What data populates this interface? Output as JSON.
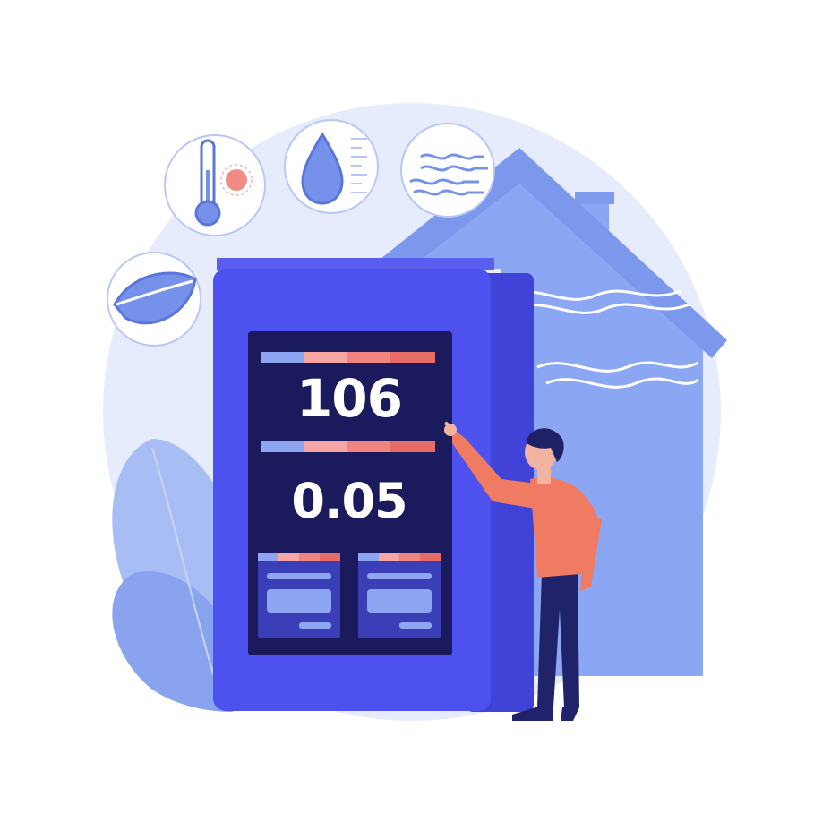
{
  "readings": {
    "primary_value": "106",
    "secondary_value": "0.05"
  },
  "icons": {
    "sensor_1": "thermometer-icon",
    "sensor_2": "water-drop-icon",
    "sensor_3": "air-flow-icon",
    "sensor_4": "leaf-icon"
  },
  "colors": {
    "device_body": "#4b4fe8",
    "device_screen": "#1b1b5e",
    "house": "#8aa6f2",
    "background_blob": "#e5ebfb",
    "accent_red": "#e86b66",
    "accent_pink": "#f19a95",
    "accent_blue": "#8ea6f2",
    "person_shirt": "#f07b63",
    "person_pants": "#20226a"
  }
}
